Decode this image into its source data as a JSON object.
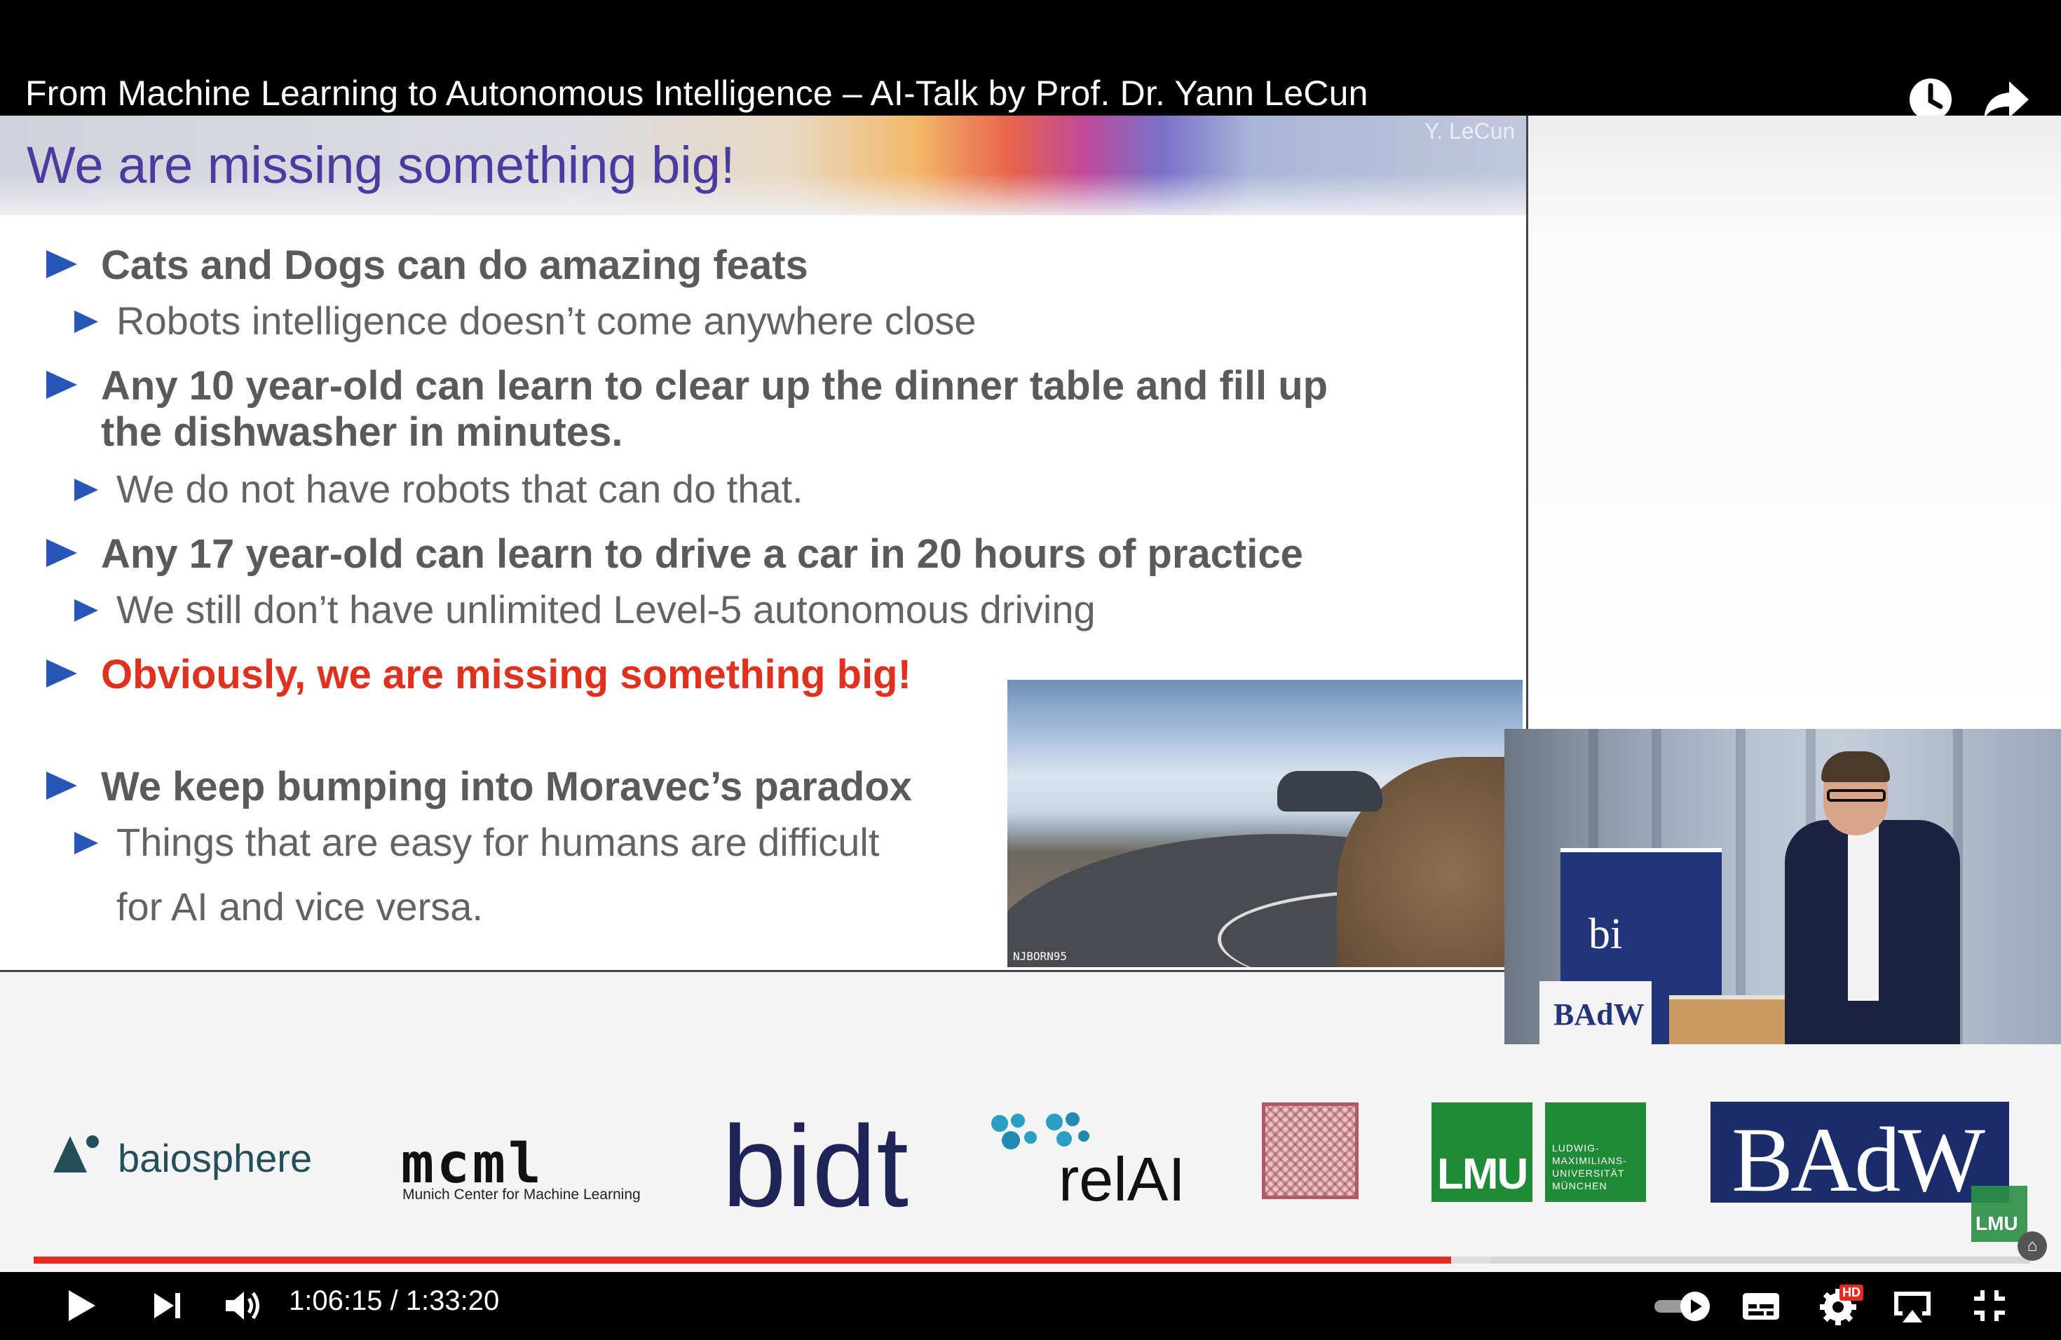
{
  "video": {
    "title": "From Machine Learning to Autonomous Intelligence – AI-Talk by Prof. Dr. Yann LeCun",
    "current_time": "1:06:15",
    "duration": "1:33:20",
    "time_text": "1:06:15 / 1:33:20",
    "progress_played": 0.71,
    "progress_buffered": 0.73,
    "hd_badge": "HD",
    "autoplay_on": true
  },
  "slide": {
    "title": "We are missing something big!",
    "author": "Y. LeCun",
    "bullets": [
      {
        "level": 1,
        "text": "Cats and Dogs can do amazing feats"
      },
      {
        "level": 2,
        "text": "Robots intelligence doesn’t come anywhere close"
      },
      {
        "level": 1,
        "text": "Any 10 year-old can learn to clear up the dinner table and fill up"
      },
      {
        "level": 1,
        "text": "the dishwasher in minutes."
      },
      {
        "level": 2,
        "text": "We do not have robots that can do that."
      },
      {
        "level": 1,
        "text": "Any 17 year-old can learn to drive a car in 20 hours of practice"
      },
      {
        "level": 2,
        "text": "We still don’t have unlimited Level-5 autonomous driving"
      },
      {
        "level": 1,
        "text": "Obviously, we are missing something big!",
        "color": "#e0301e"
      },
      {
        "level": 1,
        "text": "We keep bumping into Moravec’s paradox"
      },
      {
        "level": 2,
        "text": "Things that are easy for humans are difficult"
      },
      {
        "level": 2,
        "text": "for AI and vice versa."
      }
    ],
    "image_watermark": "NJBORN95"
  },
  "speaker_inset": {
    "podium_sign": "BAdW",
    "banner_text": "bi"
  },
  "sponsors": {
    "baiosphere": "baiosphere",
    "mcml": "mcml",
    "mcml_subtitle": "Munich Center for Machine Learning",
    "bidt": "bidt",
    "relai": "relAI",
    "lmu": "LMU",
    "lmu_name": "LUDWIG-\nMAXIMILIANS-\nUNIVERSITÄT\nMÜNCHEN",
    "badw": "BAdW",
    "corner_lmu": "LMU"
  },
  "colors": {
    "accent_red": "#e52b21",
    "bullet_blue": "#2855b8",
    "slide_title": "#4b3ba0"
  },
  "icons": {
    "watch_later": "clock-icon",
    "share": "share-arrow-icon",
    "play": "play-icon",
    "next": "skip-next-icon",
    "volume": "volume-icon",
    "autoplay": "autoplay-toggle-icon",
    "subtitles": "subtitles-icon",
    "settings": "settings-gear-icon",
    "airplay": "airplay-icon",
    "fullscreen_exit": "exit-fullscreen-icon"
  }
}
